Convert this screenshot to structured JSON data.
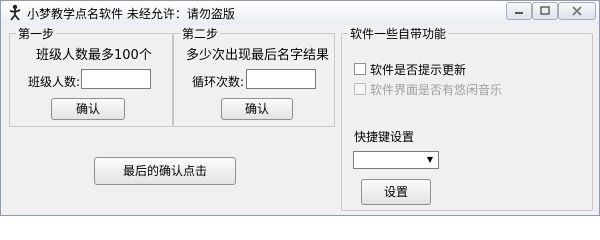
{
  "window": {
    "title": "小梦教学点名软件 未经允许：请勿盗版",
    "icons": {
      "app": "stick-figure-icon",
      "minimize": "minimize-icon",
      "maximize": "maximize-icon",
      "close": "close-icon"
    }
  },
  "step1": {
    "legend": "第一步",
    "heading": "班级人数最多100个",
    "input_label": "班级人数:",
    "input_value": "",
    "button": "确认"
  },
  "step2": {
    "legend": "第二步",
    "heading": "多少次出现最后名字结果",
    "input_label": "循环次数:",
    "input_value": "",
    "button": "确认"
  },
  "final_button": "最后的确认点击",
  "features": {
    "legend": "软件一些自带功能",
    "update_prompt": "软件是否提示更新",
    "music": "软件界面是否有悠闲音乐",
    "shortcut_label": "快捷键设置",
    "shortcut_value": "",
    "settings_button": "设置"
  }
}
